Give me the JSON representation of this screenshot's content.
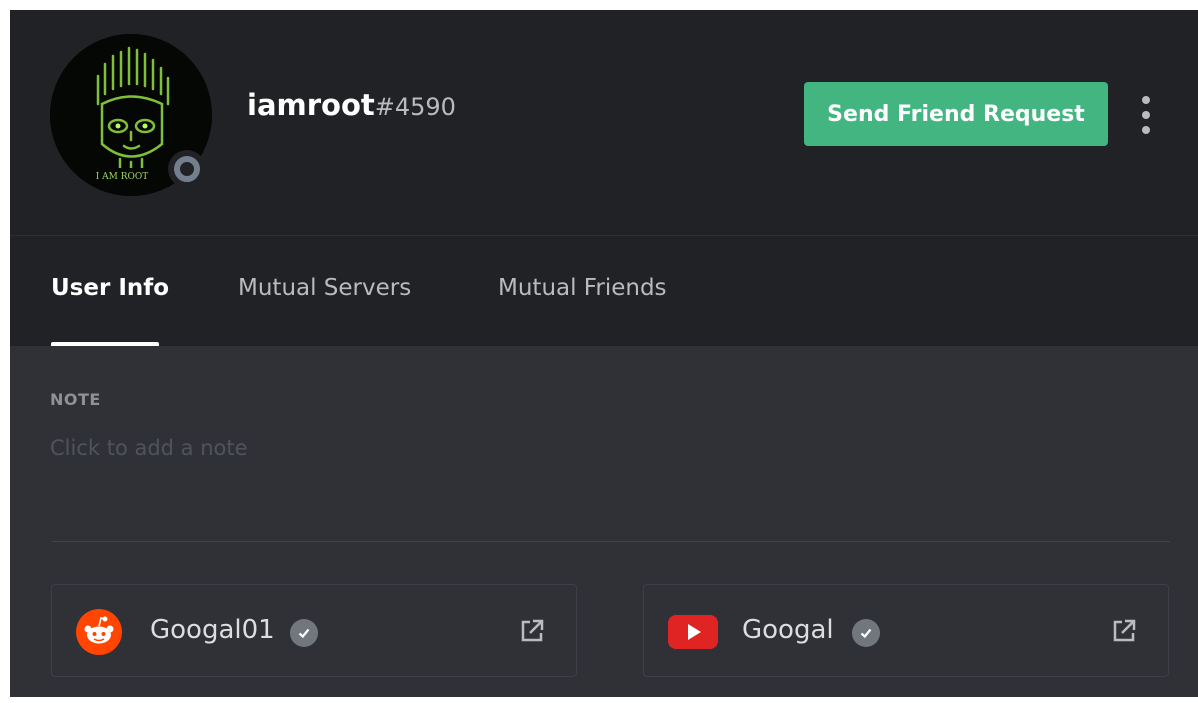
{
  "user": {
    "username": "iamroot",
    "discriminator": "#4590",
    "avatar_text": "I AM ROOT",
    "status": "offline"
  },
  "actions": {
    "friend_request_label": "Send Friend Request",
    "more_icon": "more-vertical-icon"
  },
  "tabs": [
    {
      "label": "User Info",
      "active": true
    },
    {
      "label": "Mutual Servers",
      "active": false
    },
    {
      "label": "Mutual Friends",
      "active": false
    }
  ],
  "note": {
    "label": "NOTE",
    "placeholder": "Click to add a note"
  },
  "connected_accounts": [
    {
      "service": "reddit",
      "name": "Googal01",
      "verified": true,
      "icon": "reddit-icon",
      "color": "#ff4500"
    },
    {
      "service": "youtube",
      "name": "Googal",
      "verified": true,
      "icon": "youtube-icon",
      "color": "#e02424"
    }
  ],
  "colors": {
    "header_bg": "#202225",
    "body_bg": "#2f3136",
    "friend_button": "#43b581",
    "status_offline": "#747f8d"
  }
}
